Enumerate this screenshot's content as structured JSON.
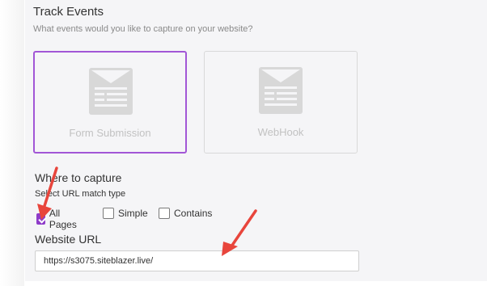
{
  "track_events": {
    "title": "Track Events",
    "subtitle": "What events would you like to capture on your website?",
    "cards": [
      {
        "label": "Form Submission",
        "selected": true,
        "icon": "form-icon"
      },
      {
        "label": "WebHook",
        "selected": false,
        "icon": "form-icon"
      }
    ]
  },
  "capture": {
    "title": "Where to capture",
    "match_label": "Select URL match type",
    "options": [
      {
        "label": "All Pages",
        "checked": true
      },
      {
        "label": "Simple",
        "checked": false
      },
      {
        "label": "Contains",
        "checked": false
      }
    ]
  },
  "website": {
    "label": "Website URL",
    "value": "https://s3075.siteblazer.live/"
  },
  "colors": {
    "accent": "#8e3bc9",
    "card_border_selected": "#a256d6",
    "arrow": "#e8453c"
  }
}
